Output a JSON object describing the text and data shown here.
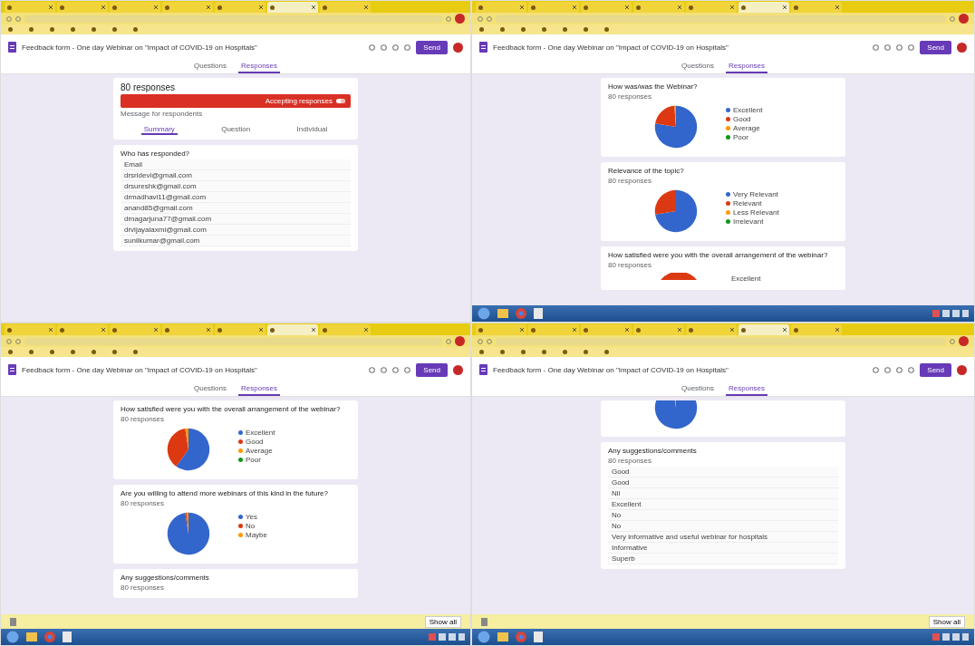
{
  "panels": [
    {
      "kind": "summary",
      "browser_tabs": [
        {
          "selected": false
        },
        {
          "selected": false
        },
        {
          "selected": false
        },
        {
          "selected": false
        },
        {
          "selected": false
        },
        {
          "selected": true
        },
        {
          "selected": false
        }
      ],
      "form_title": "Feedback form - One day Webinar on \"Impact of COVID-19 on Hospitals\"",
      "send": "Send",
      "tabs": [
        {
          "label": "Questions",
          "selected": false
        },
        {
          "label": "Responses",
          "selected": true
        }
      ],
      "responses_count": "80 responses",
      "accepting": {
        "label": "Accepting responses",
        "on": true
      },
      "message_label": "Message for respondents",
      "sub_tabs": [
        {
          "label": "Summary",
          "selected": true
        },
        {
          "label": "Question",
          "selected": false
        },
        {
          "label": "Individual",
          "selected": false
        }
      ],
      "who_title": "Who has responded?",
      "email_header": "Email",
      "emails": [
        "drsridevi@gmail.com",
        "drsureshk@gmail.com",
        "drmadhavi11@gmail.com",
        "anand85@gmail.com",
        "drnagarjuna77@gmail.com",
        "drvijayalaxmi@gmail.com",
        "sunilkumar@gmail.com"
      ]
    },
    {
      "kind": "charts",
      "browser_tabs": [
        {
          "selected": false
        },
        {
          "selected": false
        },
        {
          "selected": false
        },
        {
          "selected": false
        },
        {
          "selected": false
        },
        {
          "selected": true
        },
        {
          "selected": false
        }
      ],
      "form_title": "Feedback form - One day Webinar on \"Impact of COVID-19 on Hospitals\"",
      "send": "Send",
      "tabs": [
        {
          "label": "Questions",
          "selected": false
        },
        {
          "label": "Responses",
          "selected": true
        }
      ],
      "taskbar": true,
      "cards": [
        {
          "kind": "pie",
          "question": "How was/was the Webinar?",
          "count": "80 responses",
          "chart_data": {
            "type": "pie",
            "categories": [
              "Excellent",
              "Good",
              "Average",
              "Poor"
            ],
            "values": [
              77.5,
              21.3,
              1.2,
              0
            ],
            "colors": [
              "#3366cc",
              "#dc3912",
              "#ff9900",
              "#109618"
            ]
          }
        },
        {
          "kind": "pie",
          "question": "Relevance of the topic?",
          "count": "80 responses",
          "chart_data": {
            "type": "pie",
            "categories": [
              "Very Relevant",
              "Relevant",
              "Less Relevant",
              "Irrelevant"
            ],
            "values": [
              72.5,
              27.5,
              0,
              0
            ],
            "colors": [
              "#3366cc",
              "#dc3912",
              "#ff9900",
              "#109618"
            ]
          }
        },
        {
          "kind": "partial",
          "question": "How satisfied were you with the overall arrangement of the webinar?",
          "count": "80 responses",
          "legend": [
            "Excellent"
          ]
        }
      ]
    },
    {
      "kind": "charts",
      "browser_tabs": [
        {
          "selected": false
        },
        {
          "selected": false
        },
        {
          "selected": false
        },
        {
          "selected": false
        },
        {
          "selected": false
        },
        {
          "selected": true
        },
        {
          "selected": false
        }
      ],
      "form_title": "Feedback form - One day Webinar on \"Impact of COVID-19 on Hospitals\"",
      "send": "Send",
      "tabs": [
        {
          "label": "Questions",
          "selected": false
        },
        {
          "label": "Responses",
          "selected": true
        }
      ],
      "download": {
        "show_all": "Show all"
      },
      "taskbar": true,
      "cards": [
        {
          "kind": "pie",
          "question": "How satisfied were you with the overall arrangement of the webinar?",
          "count": "80 responses",
          "chart_data": {
            "type": "pie",
            "categories": [
              "Excellent",
              "Good",
              "Average",
              "Poor"
            ],
            "values": [
              60,
              37.5,
              2.5,
              0
            ],
            "colors": [
              "#3366cc",
              "#dc3912",
              "#ff9900",
              "#109618"
            ]
          }
        },
        {
          "kind": "pie",
          "question": "Are you willing to attend more webinars of this kind in the future?",
          "count": "80 responses",
          "chart_data": {
            "type": "pie",
            "categories": [
              "Yes",
              "No",
              "Maybe"
            ],
            "values": [
              97.5,
              1.25,
              1.25
            ],
            "colors": [
              "#3366cc",
              "#dc3912",
              "#ff9900"
            ]
          }
        },
        {
          "kind": "text",
          "question": "Any suggestions/comments",
          "count": "80 responses"
        }
      ]
    },
    {
      "kind": "charts",
      "browser_tabs": [
        {
          "selected": false
        },
        {
          "selected": false
        },
        {
          "selected": false
        },
        {
          "selected": false
        },
        {
          "selected": false
        },
        {
          "selected": true
        },
        {
          "selected": false
        }
      ],
      "form_title": "Feedback form - One day Webinar on \"Impact of COVID-19 on Hospitals\"",
      "send": "Send",
      "tabs": [
        {
          "label": "Questions",
          "selected": false
        },
        {
          "label": "Responses",
          "selected": true
        }
      ],
      "download": {
        "show_all": "Show all"
      },
      "taskbar": true,
      "cards": [
        {
          "kind": "cut_pie",
          "chart_data": {
            "type": "pie",
            "values": [
              97.5,
              1.25,
              1.25
            ],
            "colors": [
              "#3366cc",
              "#dc3912",
              "#ff9900"
            ]
          }
        },
        {
          "kind": "text",
          "question": "Any suggestions/comments",
          "count": "80 responses",
          "answers": [
            "Good",
            "Good",
            "Nil",
            "Excellent",
            "No",
            "No",
            "Very informative and useful webinar for hospitals",
            "Informative",
            "Superb"
          ]
        }
      ]
    }
  ]
}
